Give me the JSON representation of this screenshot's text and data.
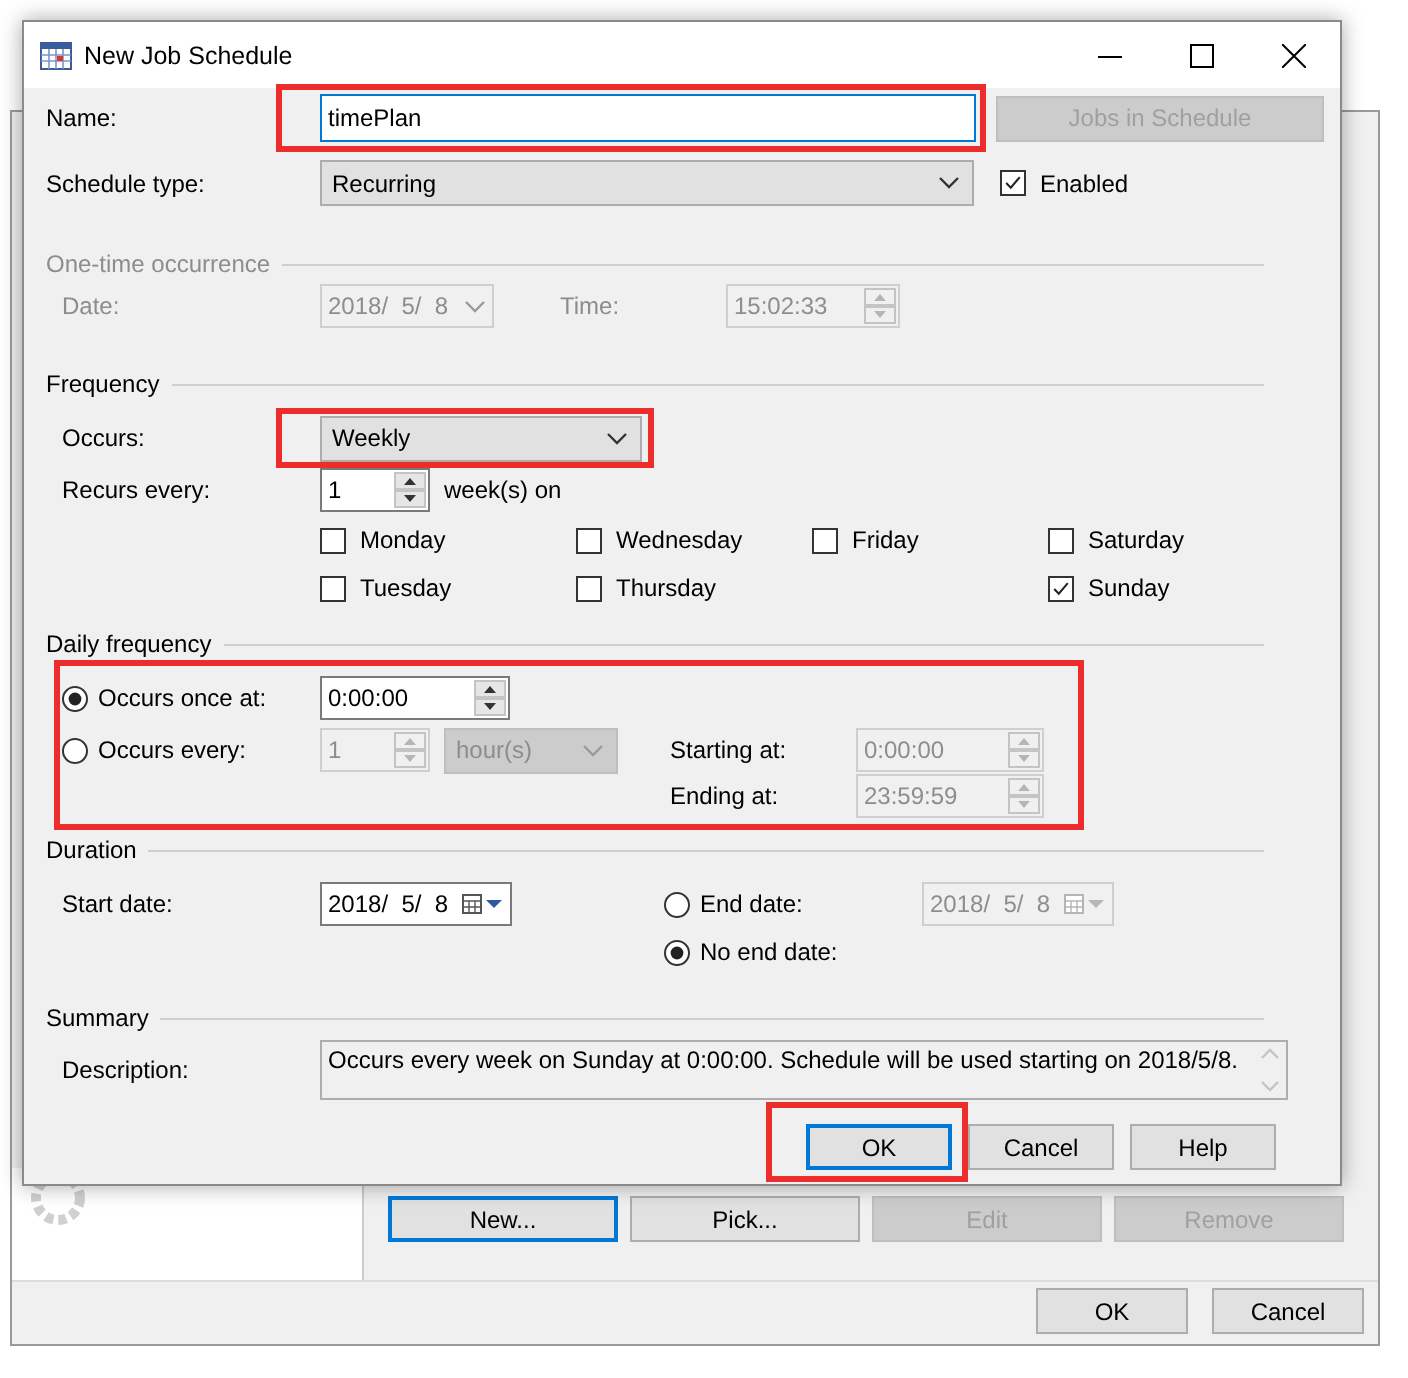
{
  "background_window": {
    "buttons": [
      {
        "label": "New...",
        "default": true,
        "disabled": false
      },
      {
        "label": "Pick...",
        "default": false,
        "disabled": false
      },
      {
        "label": "Edit",
        "default": false,
        "disabled": true
      },
      {
        "label": "Remove",
        "default": false,
        "disabled": true
      }
    ],
    "footer_buttons": [
      {
        "label": "OK"
      },
      {
        "label": "Cancel"
      }
    ]
  },
  "dialog": {
    "title": "New Job Schedule",
    "name": {
      "label": "Name:",
      "value": "timePlan",
      "highlighted": true
    },
    "jobs_button": {
      "label": "Jobs in Schedule",
      "disabled": true
    },
    "schedule_type": {
      "label": "Schedule type:",
      "value": "Recurring"
    },
    "enabled": {
      "label": "Enabled",
      "checked": true
    },
    "one_time": {
      "title": "One-time occurrence",
      "disabled": true,
      "date_label": "Date:",
      "date": "2018/  5/  8",
      "time_label": "Time:",
      "time": "15:02:33"
    },
    "frequency": {
      "title": "Frequency",
      "occurs_label": "Occurs:",
      "occurs": "Weekly",
      "occurs_highlighted": true,
      "recurs_label": "Recurs every:",
      "recurs": "1",
      "recurs_unit": "week(s) on",
      "days": [
        {
          "label": "Monday",
          "checked": false
        },
        {
          "label": "Tuesday",
          "checked": false
        },
        {
          "label": "Wednesday",
          "checked": false
        },
        {
          "label": "Thursday",
          "checked": false
        },
        {
          "label": "Friday",
          "checked": false
        },
        {
          "label": "Saturday",
          "checked": false
        },
        {
          "label": "Sunday",
          "checked": true
        }
      ]
    },
    "daily": {
      "title": "Daily frequency",
      "highlighted": true,
      "options": [
        {
          "label": "Occurs once at:",
          "selected": true,
          "value": "0:00:00"
        },
        {
          "label": "Occurs every:",
          "selected": false,
          "value": "1",
          "unit": "hour(s)"
        }
      ],
      "starting_label": "Starting at:",
      "starting": "0:00:00",
      "ending_label": "Ending at:",
      "ending": "23:59:59"
    },
    "duration": {
      "title": "Duration",
      "start_label": "Start date:",
      "start": "2018/  5/  8",
      "end_options": [
        {
          "label": "End date:",
          "selected": false,
          "value": "2018/  5/  8"
        },
        {
          "label": "No end date:",
          "selected": true
        }
      ]
    },
    "summary": {
      "title": "Summary",
      "description_label": "Description:",
      "description": "Occurs every week on Sunday at 0:00:00. Schedule will be used starting on 2018/5/8."
    },
    "buttons": [
      {
        "label": "OK",
        "default": true,
        "highlighted": true
      },
      {
        "label": "Cancel",
        "default": false,
        "highlighted": false
      },
      {
        "label": "Help",
        "default": false,
        "highlighted": false
      }
    ]
  }
}
